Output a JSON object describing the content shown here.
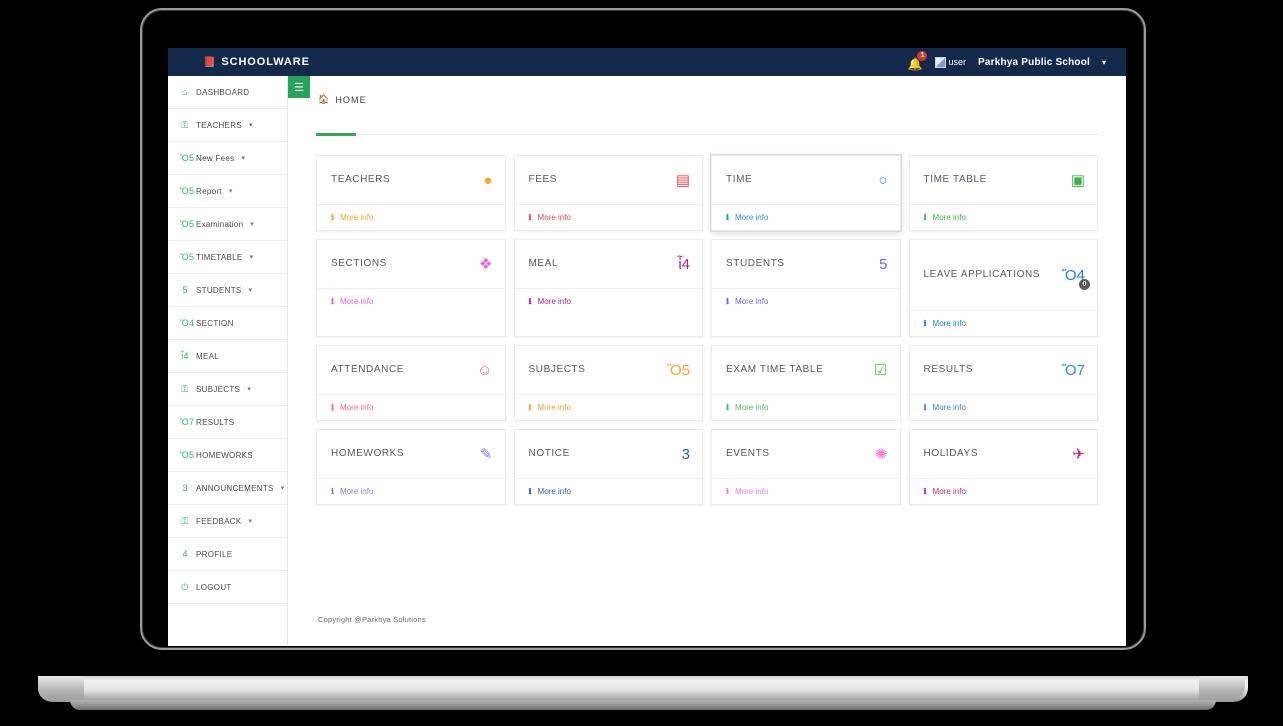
{
  "navbar": {
    "brand": "SCHOOLWARE",
    "brand_icon": "book-icon",
    "notification_icon": "bell-icon",
    "notification_count": "1",
    "avatar_alt": "user",
    "school_name": "Parkhya Public School",
    "dropdown_caret": "▾"
  },
  "sidebar": {
    "items": [
      {
        "label": "DASHBOARD",
        "icon": "home-icon",
        "glyph": "⌂",
        "caret": ""
      },
      {
        "label": "TEACHERS",
        "icon": "lock-icon",
        "glyph": "⚿",
        "caret": "▾"
      },
      {
        "label": "New Fees",
        "icon": "calendar-icon",
        "glyph": "Ὄ5",
        "caret": "▾"
      },
      {
        "label": "Report",
        "icon": "calendar-icon",
        "glyph": "Ὄ5",
        "caret": "▾"
      },
      {
        "label": "Examination",
        "icon": "calendar-icon",
        "glyph": "Ὄ5",
        "caret": "▾"
      },
      {
        "label": "TIMETABLE",
        "icon": "calendar-icon",
        "glyph": "Ὄ5",
        "caret": "▾"
      },
      {
        "label": "STUDENTS",
        "icon": "users-icon",
        "glyph": "὆5",
        "caret": "▾"
      },
      {
        "label": "SECTION",
        "icon": "file-icon",
        "glyph": "Ὄ4",
        "caret": ""
      },
      {
        "label": "MEAL",
        "icon": "cutlery-icon",
        "glyph": "ἷ4",
        "caret": ""
      },
      {
        "label": "SUBJECTS",
        "icon": "lock-icon",
        "glyph": "⚿",
        "caret": "▾"
      },
      {
        "label": "RESULTS",
        "icon": "id-card-icon",
        "glyph": "Ὄ7",
        "caret": ""
      },
      {
        "label": "HOMEWORKS",
        "icon": "book-icon",
        "glyph": "Ὅ5",
        "caret": ""
      },
      {
        "label": "ANNOUNCEMENTS",
        "icon": "bullhorn-icon",
        "glyph": "὎3",
        "caret": "▾"
      },
      {
        "label": "FEEDBACK",
        "icon": "lock-icon",
        "glyph": "⚿",
        "caret": "▾"
      },
      {
        "label": "PROFILE",
        "icon": "user-icon",
        "glyph": "὆4",
        "caret": ""
      },
      {
        "label": "LOGOUT",
        "icon": "power-icon",
        "glyph": "⏻",
        "caret": ""
      }
    ]
  },
  "main": {
    "hamburger_icon": "hamburger-menu-icon",
    "hamburger_glyph": "☰",
    "breadcrumb_icon": "home-icon",
    "breadcrumb_glyph": "⌂",
    "breadcrumb": "HOME",
    "more_info_label": "More info",
    "info_glyph": "ℹ",
    "footer": "Copyright @Parkhya Solutions"
  },
  "cards": [
    [
      {
        "title": "TEACHERS",
        "icon": "user-circle-icon",
        "glyph": "●",
        "color": "#f5a623",
        "hovered": false,
        "badge": null,
        "tall": false
      },
      {
        "title": "FEES",
        "icon": "money-bill-icon",
        "glyph": "▤",
        "color": "#f0464c",
        "hovered": false,
        "badge": null,
        "tall": false
      },
      {
        "title": "TIME",
        "icon": "clock-icon",
        "glyph": "○",
        "color": "#1a8fe3",
        "hovered": true,
        "badge": null,
        "tall": false
      },
      {
        "title": "TIME TABLE",
        "icon": "calendar-plus-icon",
        "glyph": "▣",
        "color": "#3bb54a",
        "hovered": false,
        "badge": null,
        "tall": false
      }
    ],
    [
      {
        "title": "SECTIONS",
        "icon": "cubes-icon",
        "glyph": "❖",
        "color": "#f55fc8",
        "hovered": false,
        "badge": null,
        "tall": false
      },
      {
        "title": "MEAL",
        "icon": "cutlery-icon",
        "glyph": "ἷ4",
        "color": "#b0228c",
        "hovered": false,
        "badge": null,
        "tall": false
      },
      {
        "title": "STUDENTS",
        "icon": "users-icon",
        "glyph": "὆5",
        "color": "#7b61f0",
        "hovered": false,
        "badge": null,
        "tall": false
      },
      {
        "title": "LEAVE APPLICATIONS",
        "icon": "file-text-icon",
        "glyph": "Ὄ4",
        "color": "#1a7fd4",
        "hovered": false,
        "badge": "0",
        "tall": true
      }
    ],
    [
      {
        "title": "ATTENDANCE",
        "icon": "user-plus-icon",
        "glyph": "☺",
        "color": "#f76c6c",
        "hovered": false,
        "badge": null,
        "tall": false
      },
      {
        "title": "SUBJECTS",
        "icon": "book-icon",
        "glyph": "Ὅ5",
        "color": "#f2a42c",
        "hovered": false,
        "badge": null,
        "tall": false
      },
      {
        "title": "EXAM TIME TABLE",
        "icon": "calendar-check-icon",
        "glyph": "☑",
        "color": "#4bbf5a",
        "hovered": false,
        "badge": null,
        "tall": false
      },
      {
        "title": "RESULTS",
        "icon": "id-card-icon",
        "glyph": "Ὄ7",
        "color": "#2a8fd8",
        "hovered": false,
        "badge": null,
        "tall": false
      }
    ],
    [
      {
        "title": "HOMEWORKS",
        "icon": "pencil-icon",
        "glyph": "✎",
        "color": "#8b7bea",
        "hovered": false,
        "badge": null,
        "tall": false
      },
      {
        "title": "NOTICE",
        "icon": "bullhorn-icon",
        "glyph": "὎3",
        "color": "#2e5fa3",
        "hovered": false,
        "badge": null,
        "tall": false
      },
      {
        "title": "EVENTS",
        "icon": "hand-sparkle-icon",
        "glyph": "✺",
        "color": "#f77fd0",
        "hovered": false,
        "badge": null,
        "tall": false
      },
      {
        "title": "HOLIDAYS",
        "icon": "plane-icon",
        "glyph": "✈",
        "color": "#c9267f",
        "hovered": false,
        "badge": null,
        "tall": false
      }
    ]
  ]
}
